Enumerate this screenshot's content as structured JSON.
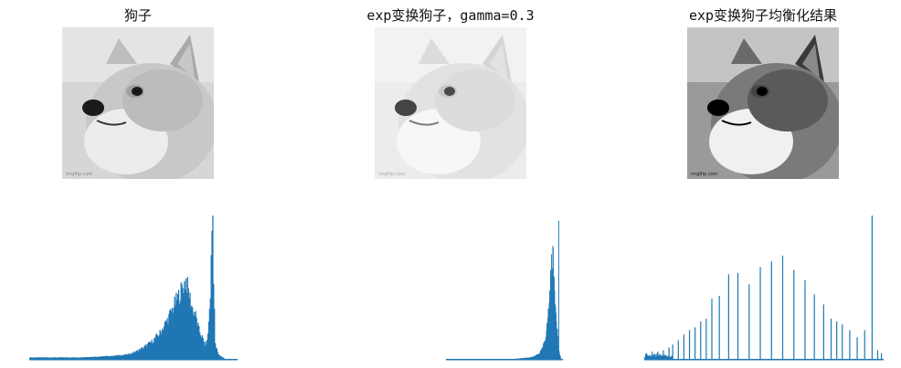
{
  "panels": [
    {
      "title": "狗子",
      "image": "doge-photo-grayscale",
      "image_watermark": "imgflip.com",
      "tone": "original"
    },
    {
      "title": "exp变换狗子，gamma=0.3",
      "image": "doge-photo-gamma-brightened",
      "image_watermark": "imgflip.com",
      "tone": "bright"
    },
    {
      "title": "exp变换狗子均衡化结果",
      "image": "doge-photo-equalized",
      "image_watermark": "imgflip.com",
      "tone": "equalized"
    }
  ],
  "colors": {
    "bar": "#1f77b4",
    "background": "#ffffff"
  },
  "chart_data": [
    {
      "type": "bar",
      "title": "",
      "axes_visible": false,
      "xlim": [
        0,
        255
      ],
      "ylim": [
        0,
        1
      ],
      "description_values": "relative pixel counts per intensity bin (0-255), normalized to max",
      "bins": [
        [
          0,
          0.01
        ],
        [
          20,
          0.01
        ],
        [
          40,
          0.01
        ],
        [
          60,
          0.01
        ],
        [
          80,
          0.015
        ],
        [
          100,
          0.02
        ],
        [
          120,
          0.03
        ],
        [
          130,
          0.05
        ],
        [
          140,
          0.08
        ],
        [
          150,
          0.12
        ],
        [
          160,
          0.18
        ],
        [
          170,
          0.28
        ],
        [
          178,
          0.38
        ],
        [
          184,
          0.45
        ],
        [
          188,
          0.5
        ],
        [
          192,
          0.55
        ],
        [
          196,
          0.45
        ],
        [
          200,
          0.35
        ],
        [
          204,
          0.3
        ],
        [
          208,
          0.2
        ],
        [
          212,
          0.15
        ],
        [
          215,
          0.1
        ],
        [
          218,
          0.12
        ],
        [
          220,
          0.25
        ],
        [
          222,
          0.45
        ],
        [
          224,
          0.9
        ],
        [
          225,
          1.0
        ],
        [
          226,
          0.6
        ],
        [
          228,
          0.1
        ],
        [
          232,
          0.03
        ],
        [
          240,
          0.0
        ]
      ]
    },
    {
      "type": "bar",
      "title": "",
      "axes_visible": false,
      "xlim": [
        0,
        255
      ],
      "ylim": [
        0,
        1
      ],
      "bins": [
        [
          0,
          0.0
        ],
        [
          150,
          0.0
        ],
        [
          185,
          0.01
        ],
        [
          195,
          0.02
        ],
        [
          205,
          0.04
        ],
        [
          212,
          0.08
        ],
        [
          218,
          0.15
        ],
        [
          222,
          0.25
        ],
        [
          226,
          0.4
        ],
        [
          229,
          0.55
        ],
        [
          232,
          0.7
        ],
        [
          234,
          0.75
        ],
        [
          236,
          0.6
        ],
        [
          238,
          0.5
        ],
        [
          240,
          0.38
        ],
        [
          242,
          0.3
        ],
        [
          244,
          0.2
        ],
        [
          246,
          0.1
        ],
        [
          247,
          1.0
        ],
        [
          248,
          0.05
        ],
        [
          252,
          0.0
        ]
      ]
    },
    {
      "type": "bar",
      "title": "",
      "axes_visible": false,
      "xlim": [
        0,
        255
      ],
      "ylim": [
        0,
        1
      ],
      "baseline_noise": 0.03,
      "spikes": [
        [
          2,
          0.04
        ],
        [
          8,
          0.05
        ],
        [
          14,
          0.05
        ],
        [
          20,
          0.06
        ],
        [
          26,
          0.08
        ],
        [
          30,
          0.1
        ],
        [
          36,
          0.13
        ],
        [
          42,
          0.17
        ],
        [
          48,
          0.2
        ],
        [
          54,
          0.22
        ],
        [
          60,
          0.26
        ],
        [
          66,
          0.28
        ],
        [
          72,
          0.42
        ],
        [
          80,
          0.44
        ],
        [
          90,
          0.59
        ],
        [
          100,
          0.6
        ],
        [
          112,
          0.52
        ],
        [
          124,
          0.64
        ],
        [
          136,
          0.68
        ],
        [
          148,
          0.72
        ],
        [
          160,
          0.62
        ],
        [
          172,
          0.55
        ],
        [
          182,
          0.45
        ],
        [
          192,
          0.38
        ],
        [
          200,
          0.28
        ],
        [
          206,
          0.26
        ],
        [
          212,
          0.24
        ],
        [
          220,
          0.2
        ],
        [
          228,
          0.15
        ],
        [
          236,
          0.2
        ],
        [
          244,
          1.0
        ],
        [
          250,
          0.06
        ],
        [
          254,
          0.04
        ]
      ]
    }
  ]
}
